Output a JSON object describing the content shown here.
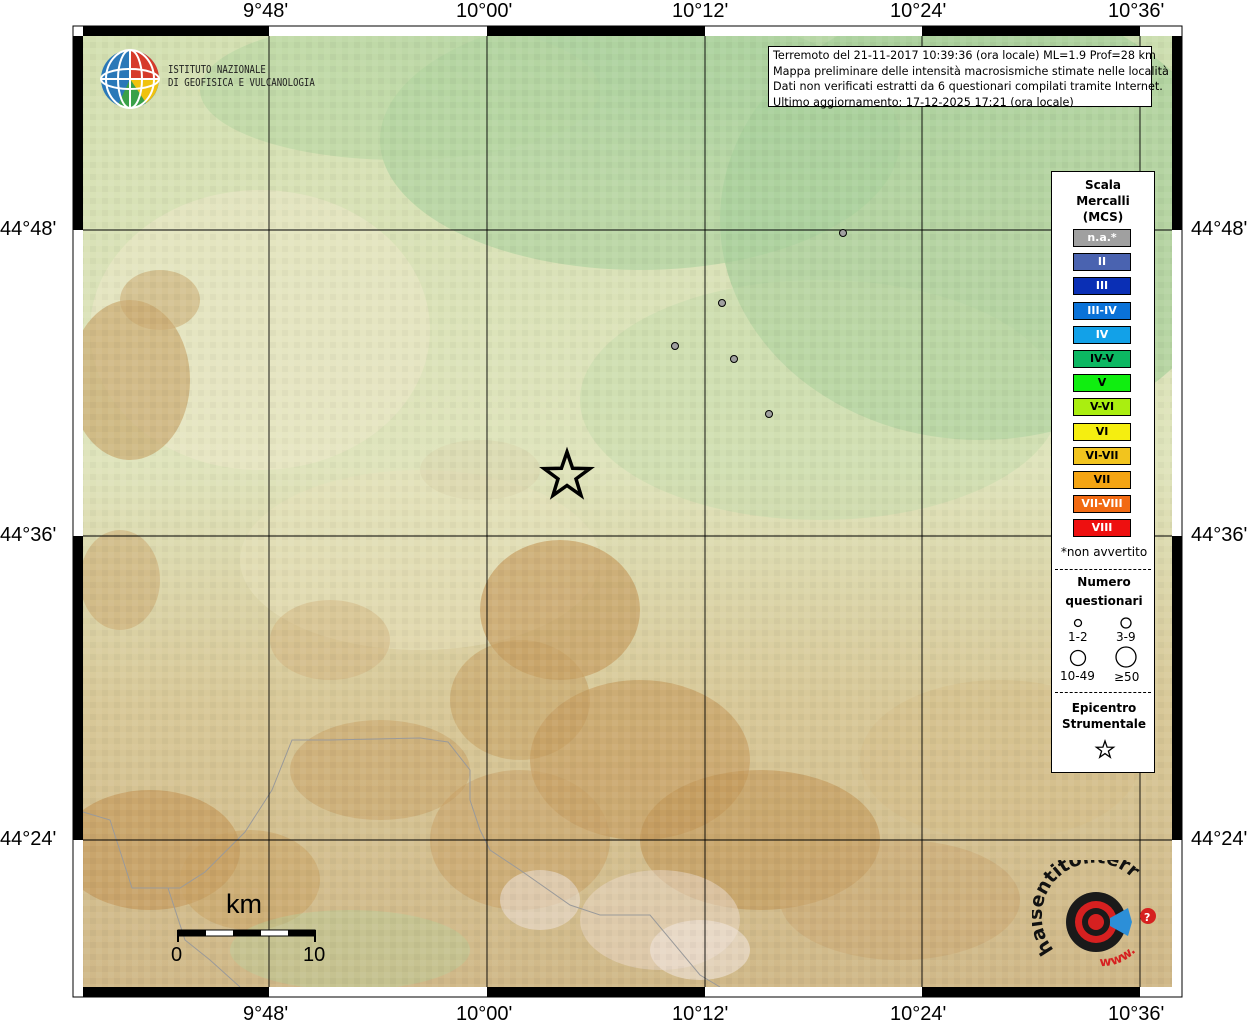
{
  "map": {
    "lon_labels": [
      "9°48'",
      "10°00'",
      "10°12'",
      "10°24'",
      "10°36'"
    ],
    "lat_labels": [
      "44°48'",
      "44°36'",
      "44°24'"
    ]
  },
  "info": {
    "line1": "Terremoto del 21-11-2017 10:39:36 (ora locale) ML=1.9 Prof=28 km",
    "line2": "Mappa preliminare delle intensità macrosismiche stimate nelle località",
    "line3": "Dati non verificati estratti da 6 questionari compilati tramite Internet.",
    "line4": "Ultimo aggiornamento: 17-12-2025 17:21 (ora locale)"
  },
  "logo": {
    "line1": "ISTITUTO NAZIONALE",
    "line2": "DI GEOFISICA E VULCANOLOGIA"
  },
  "legend": {
    "title1": "Scala",
    "title2": "Mercalli",
    "title3": "(MCS)",
    "intensities": [
      {
        "label": "n.a.*",
        "color": "#a0a0a0"
      },
      {
        "label": "II",
        "color": "#4a63b0"
      },
      {
        "label": "III",
        "color": "#0a2fb5"
      },
      {
        "label": "III-IV",
        "color": "#0a72d8"
      },
      {
        "label": "IV",
        "color": "#12a1e8"
      },
      {
        "label": "IV-V",
        "color": "#0cb862"
      },
      {
        "label": "V",
        "color": "#10ee10"
      },
      {
        "label": "V-VI",
        "color": "#aaee10"
      },
      {
        "label": "VI",
        "color": "#f5ee10"
      },
      {
        "label": "VI-VII",
        "color": "#f2c41e"
      },
      {
        "label": "VII",
        "color": "#f4a412"
      },
      {
        "label": "VII-VIII",
        "color": "#f26a12"
      },
      {
        "label": "VIII",
        "color": "#ee1010"
      }
    ],
    "not_felt_note": "*non avvertito",
    "count_title1": "Numero",
    "count_title2": "questionari",
    "count_1": "1-2",
    "count_2": "3-9",
    "count_3": "10-49",
    "count_4": "≥50",
    "epi_title1": "Epicentro",
    "epi_title2": "Strumentale"
  },
  "scale": {
    "unit": "km",
    "start": "0",
    "end": "10"
  },
  "brand": {
    "text": "haisentitoilterremoto.it",
    "url": "www."
  }
}
